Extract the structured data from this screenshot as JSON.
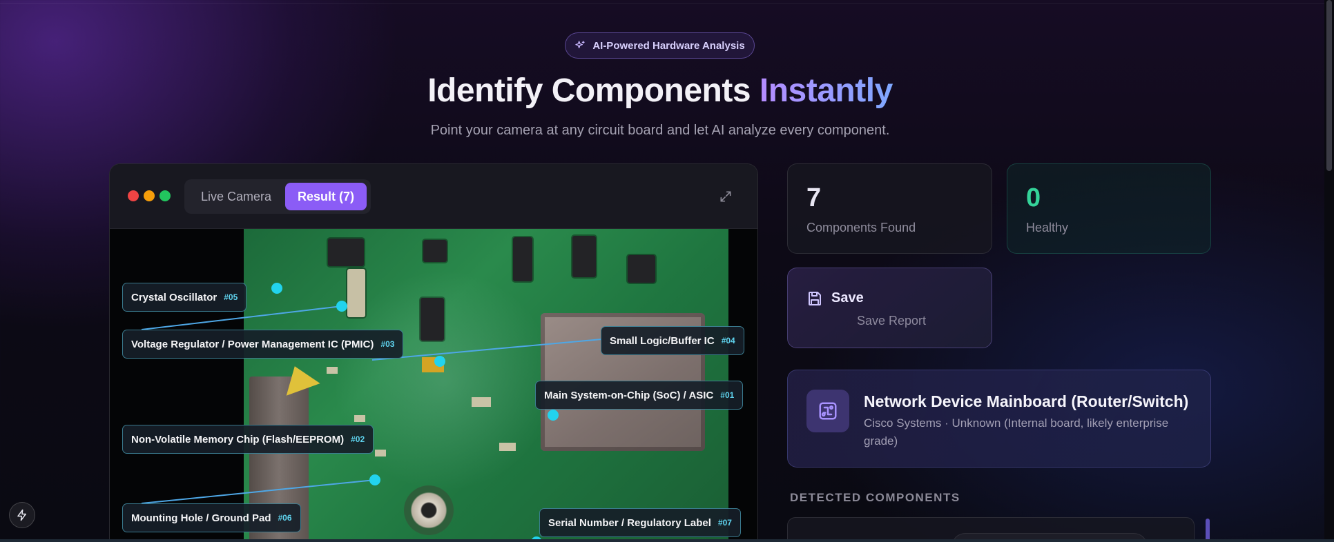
{
  "hero": {
    "badge": "AI-Powered Hardware Analysis",
    "title_part1": "Identify Components ",
    "title_part2": "Instantly",
    "subtitle": "Point your camera at any circuit board and let AI analyze every component."
  },
  "panel": {
    "tabs": [
      {
        "label": "Live Camera",
        "active": false
      },
      {
        "label": "Result (7)",
        "active": true
      }
    ],
    "labels": [
      {
        "text": "Crystal Oscillator",
        "num": "#05"
      },
      {
        "text": "Voltage Regulator / Power Management IC (PMIC)",
        "num": "#03"
      },
      {
        "text": "Small Logic/Buffer IC",
        "num": "#04"
      },
      {
        "text": "Main System-on-Chip (SoC) / ASIC",
        "num": "#01"
      },
      {
        "text": "Non-Volatile Memory Chip (Flash/EEPROM)",
        "num": "#02"
      },
      {
        "text": "Mounting Hole / Ground Pad",
        "num": "#06"
      },
      {
        "text": "Serial Number / Regulatory Label",
        "num": "#07"
      }
    ]
  },
  "stats": {
    "found": {
      "value": "7",
      "label": "Components Found"
    },
    "healthy": {
      "value": "0",
      "label": "Healthy"
    }
  },
  "save": {
    "title": "Save",
    "subtitle": "Save Report"
  },
  "device": {
    "title": "Network Device Mainboard (Router/Switch)",
    "subtitle": "Cisco Systems · Unknown (Internal board, likely enterprise grade)"
  },
  "section": {
    "detected": "DETECTED COMPONENTS"
  },
  "colors": {
    "accent": "#8b5cf6",
    "healthy": "#34d399",
    "marker": "#22d3ee"
  },
  "icons": {
    "badge": "sparkle-icon",
    "expand": "expand-icon",
    "save": "floppy-icon",
    "device": "circuit-icon",
    "flash": "lightning-icon"
  }
}
